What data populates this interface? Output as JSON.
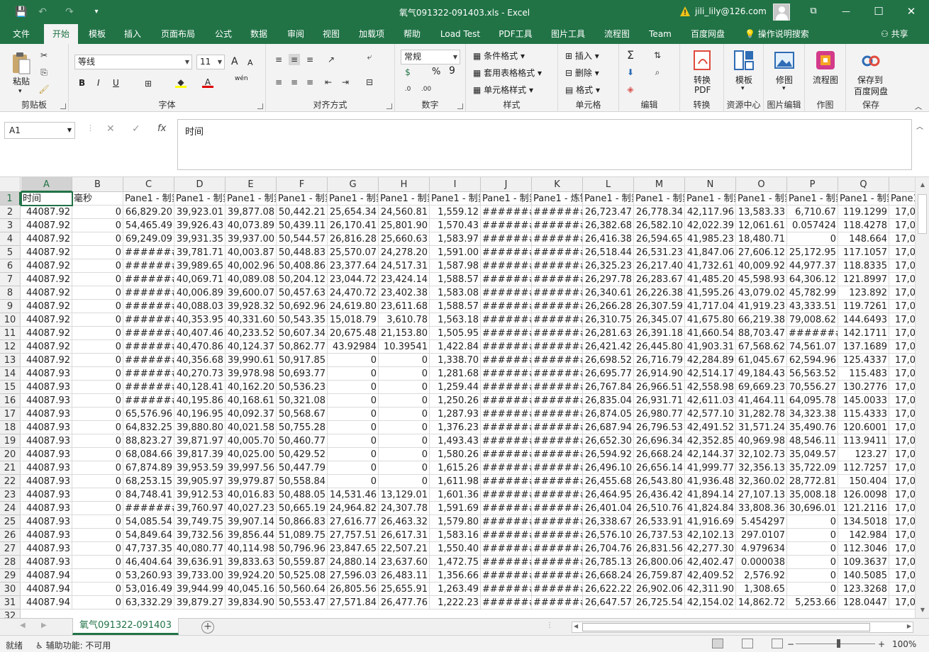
{
  "title_bar": {
    "title": "氧气091322-091403.xls  -  Excel",
    "user": "jili_lily@126.com",
    "qa_save": "💾",
    "qa_undo": "↶",
    "qa_redo": "↷",
    "qa_more": "▾",
    "minimize": "—",
    "restore": "☐",
    "close": "✕",
    "ribbon_opts": "⧉"
  },
  "menu": {
    "tabs": [
      "文件",
      "开始",
      "模板",
      "插入",
      "页面布局",
      "公式",
      "数据",
      "审阅",
      "视图",
      "加载项",
      "帮助",
      "Load Test",
      "PDF工具",
      "图片工具",
      "流程图",
      "Team",
      "百度网盘"
    ],
    "active": "开始",
    "search": "操作说明搜索",
    "share": "共享"
  },
  "ribbon": {
    "clipboard": {
      "label": "剪贴板",
      "paste": "粘贴"
    },
    "font": {
      "label": "字体",
      "name": "等线",
      "size": "11",
      "bold": "B",
      "italic": "I",
      "underline": "U",
      "grow": "A",
      "shrink": "A",
      "wen": "wén"
    },
    "align": {
      "label": "对齐方式"
    },
    "number": {
      "label": "数字",
      "format": "常规",
      "percent": "%",
      "comma": "9"
    },
    "styles": {
      "label": "样式",
      "cond": "条件格式",
      "table": "套用表格格式",
      "cell": "单元格样式"
    },
    "cells": {
      "label": "单元格",
      "insert": "插入",
      "delete": "删除",
      "format": "格式"
    },
    "edit": {
      "label": "编辑"
    },
    "convert": {
      "label": "转换",
      "btn1": "转换",
      "btn2": "PDF"
    },
    "template": {
      "label": "资源中心",
      "btn": "模板"
    },
    "image": {
      "label": "图片编辑",
      "btn": "修图"
    },
    "chart": {
      "label": "作图",
      "btn": "流程图"
    },
    "save": {
      "label": "保存",
      "btn1": "保存到",
      "btn2": "百度网盘"
    }
  },
  "formula_bar": {
    "name_box": "A1",
    "content": "时间",
    "cancel": "✕",
    "enter": "✓",
    "fx": "fx"
  },
  "sheet": {
    "columns": [
      "A",
      "B",
      "C",
      "D",
      "E",
      "F",
      "G",
      "H",
      "I",
      "J",
      "K",
      "L",
      "M",
      "N",
      "O",
      "P",
      "Q",
      ""
    ],
    "header_row": [
      "时间",
      "毫秒",
      "Pane1 - 制氢",
      "Pane1 - 制氢",
      "Pane1 - 制氢",
      "Pane1 - 制氢",
      "Pane1 - 制氢",
      "Pane1 - 制氢",
      "Pane1 - 制氢",
      "Pane1 - 制氢",
      "Pane1 - 炼铁",
      "Pane1 - 制氢",
      "Pane1 - 制氢",
      "Pane1 - 制氢",
      "Pane1 - 制氢",
      "Pane1 - 制氢",
      "Pane1 - 制氢",
      "Pane1"
    ],
    "rows": [
      [
        "44087.92",
        "0",
        "66,829.20",
        "39,923.01",
        "39,877.08",
        "50,442.21",
        "25,654.34",
        "24,560.81",
        "1,559.12",
        "#######",
        "#######",
        "26,723.47",
        "26,778.34",
        "42,117.96",
        "13,583.33",
        "6,710.67",
        "119.1299",
        "17,0"
      ],
      [
        "44087.92",
        "0",
        "54,465.49",
        "39,926.43",
        "40,073.89",
        "50,439.11",
        "26,170.41",
        "25,801.90",
        "1,570.43",
        "#######",
        "#######",
        "26,382.68",
        "26,582.10",
        "42,022.39",
        "12,061.61",
        "0.057424",
        "118.4278",
        "17,0"
      ],
      [
        "44087.92",
        "0",
        "69,249.09",
        "39,931.35",
        "39,937.00",
        "50,544.57",
        "26,816.28",
        "25,660.63",
        "1,583.97",
        "#######",
        "#######",
        "26,416.38",
        "26,594.65",
        "41,985.23",
        "18,480.71",
        "0",
        "148.664",
        "17,0"
      ],
      [
        "44087.92",
        "0",
        "#######",
        "39,781.71",
        "40,003.87",
        "50,448.83",
        "25,570.07",
        "24,278.20",
        "1,591.00",
        "#######",
        "#######",
        "26,518.44",
        "26,531.23",
        "41,847.06",
        "27,606.12",
        "25,172.95",
        "117.1057",
        "17,0"
      ],
      [
        "44087.92",
        "0",
        "#######",
        "39,989.65",
        "40,002.96",
        "50,408.86",
        "23,377.64",
        "24,517.31",
        "1,587.98",
        "#######",
        "#######",
        "26,325.23",
        "26,217.40",
        "41,732.61",
        "40,009.92",
        "44,977.37",
        "118.8335",
        "17,0"
      ],
      [
        "44087.92",
        "0",
        "#######",
        "40,069.71",
        "40,089.08",
        "50,204.12",
        "23,044.72",
        "23,424.14",
        "1,588.57",
        "#######",
        "#######",
        "26,297.78",
        "26,283.67",
        "41,485.20",
        "45,598.93",
        "64,306.12",
        "121.8997",
        "17,0"
      ],
      [
        "44087.92",
        "0",
        "#######",
        "40,006.89",
        "39,600.07",
        "50,457.63",
        "24,470.72",
        "23,402.38",
        "1,583.08",
        "#######",
        "#######",
        "26,340.61",
        "26,226.38",
        "41,595.26",
        "43,079.02",
        "45,782.99",
        "123.892",
        "17,0"
      ],
      [
        "44087.92",
        "0",
        "#######",
        "40,088.03",
        "39,928.32",
        "50,692.96",
        "24,619.80",
        "23,611.68",
        "1,588.57",
        "#######",
        "#######",
        "26,266.28",
        "26,307.59",
        "41,717.04",
        "41,919.23",
        "43,333.51",
        "119.7261",
        "17,0"
      ],
      [
        "44087.92",
        "0",
        "#######",
        "40,353.95",
        "40,331.60",
        "50,543.35",
        "15,018.79",
        "3,610.78",
        "1,563.18",
        "#######",
        "#######",
        "26,310.75",
        "26,345.07",
        "41,675.80",
        "66,219.38",
        "79,008.62",
        "144.6493",
        "17,0"
      ],
      [
        "44087.92",
        "0",
        "#######",
        "40,407.46",
        "40,233.52",
        "50,607.34",
        "20,675.48",
        "21,153.80",
        "1,505.95",
        "#######",
        "#######",
        "26,281.63",
        "26,391.18",
        "41,660.54",
        "88,703.47",
        "#######",
        "142.1711",
        "17,0"
      ],
      [
        "44087.92",
        "0",
        "#######",
        "40,470.86",
        "40,124.37",
        "50,862.77",
        "43.92984",
        "10.39541",
        "1,422.84",
        "#######",
        "#######",
        "26,421.42",
        "26,445.80",
        "41,903.31",
        "67,568.62",
        "74,561.07",
        "137.1689",
        "17,0"
      ],
      [
        "44087.92",
        "0",
        "#######",
        "40,356.68",
        "39,990.61",
        "50,917.85",
        "0",
        "0",
        "1,338.70",
        "#######",
        "#######",
        "26,698.52",
        "26,716.79",
        "42,284.89",
        "61,045.67",
        "62,594.96",
        "125.4337",
        "17,0"
      ],
      [
        "44087.93",
        "0",
        "#######",
        "40,270.73",
        "39,978.98",
        "50,693.77",
        "0",
        "0",
        "1,281.68",
        "#######",
        "#######",
        "26,695.77",
        "26,914.90",
        "42,514.17",
        "49,184.43",
        "56,563.52",
        "115.483",
        "17,0"
      ],
      [
        "44087.93",
        "0",
        "#######",
        "40,128.41",
        "40,162.20",
        "50,536.23",
        "0",
        "0",
        "1,259.44",
        "#######",
        "#######",
        "26,767.84",
        "26,966.51",
        "42,558.98",
        "69,669.23",
        "70,556.27",
        "130.2776",
        "17,0"
      ],
      [
        "44087.93",
        "0",
        "#######",
        "40,195.86",
        "40,168.61",
        "50,321.08",
        "0",
        "0",
        "1,250.26",
        "#######",
        "#######",
        "26,835.04",
        "26,931.71",
        "42,611.03",
        "41,464.11",
        "64,095.78",
        "145.0033",
        "17,0"
      ],
      [
        "44087.93",
        "0",
        "65,576.96",
        "40,196.95",
        "40,092.37",
        "50,568.67",
        "0",
        "0",
        "1,287.93",
        "#######",
        "#######",
        "26,874.05",
        "26,980.77",
        "42,577.10",
        "31,282.78",
        "34,323.38",
        "115.4333",
        "17,0"
      ],
      [
        "44087.93",
        "0",
        "64,832.25",
        "39,880.80",
        "40,021.58",
        "50,755.28",
        "0",
        "0",
        "1,376.23",
        "#######",
        "#######",
        "26,687.94",
        "26,796.53",
        "42,491.52",
        "31,571.24",
        "35,490.76",
        "120.6001",
        "17,0"
      ],
      [
        "44087.93",
        "0",
        "88,823.27",
        "39,871.97",
        "40,005.70",
        "50,460.77",
        "0",
        "0",
        "1,493.43",
        "#######",
        "#######",
        "26,652.30",
        "26,696.34",
        "42,352.85",
        "40,969.98",
        "48,546.11",
        "113.9411",
        "17,0"
      ],
      [
        "44087.93",
        "0",
        "68,084.66",
        "39,817.39",
        "40,025.00",
        "50,429.52",
        "0",
        "0",
        "1,580.26",
        "#######",
        "#######",
        "26,594.92",
        "26,668.24",
        "42,144.37",
        "32,102.73",
        "35,049.57",
        "123.27",
        "17,0"
      ],
      [
        "44087.93",
        "0",
        "67,874.89",
        "39,953.59",
        "39,997.56",
        "50,447.79",
        "0",
        "0",
        "1,615.26",
        "#######",
        "#######",
        "26,496.10",
        "26,656.14",
        "41,999.77",
        "32,356.13",
        "35,722.09",
        "112.7257",
        "17,0"
      ],
      [
        "44087.93",
        "0",
        "68,253.15",
        "39,905.97",
        "39,979.87",
        "50,558.84",
        "0",
        "0",
        "1,611.98",
        "#######",
        "#######",
        "26,455.68",
        "26,543.80",
        "41,936.48",
        "32,360.02",
        "28,772.81",
        "150.404",
        "17,0"
      ],
      [
        "44087.93",
        "0",
        "84,748.41",
        "39,912.53",
        "40,016.83",
        "50,488.05",
        "14,531.46",
        "13,129.01",
        "1,601.36",
        "#######",
        "#######",
        "26,464.95",
        "26,436.42",
        "41,894.14",
        "27,107.13",
        "35,008.18",
        "126.0098",
        "17,0"
      ],
      [
        "44087.93",
        "0",
        "#######",
        "39,760.97",
        "40,027.23",
        "50,665.19",
        "24,964.82",
        "24,307.78",
        "1,591.69",
        "#######",
        "#######",
        "26,401.04",
        "26,510.76",
        "41,824.84",
        "33,808.36",
        "30,696.01",
        "121.2116",
        "17,0"
      ],
      [
        "44087.93",
        "0",
        "54,085.54",
        "39,749.75",
        "39,907.14",
        "50,866.83",
        "27,616.77",
        "26,463.32",
        "1,579.80",
        "#######",
        "#######",
        "26,338.67",
        "26,533.91",
        "41,916.69",
        "5.454297",
        "0",
        "134.5018",
        "17,0"
      ],
      [
        "44087.93",
        "0",
        "54,849.64",
        "39,732.56",
        "39,856.44",
        "51,089.75",
        "27,757.51",
        "26,617.31",
        "1,583.16",
        "#######",
        "#######",
        "26,576.10",
        "26,737.53",
        "42,102.13",
        "297.0107",
        "0",
        "142.984",
        "17,0"
      ],
      [
        "44087.93",
        "0",
        "47,737.35",
        "40,080.77",
        "40,114.98",
        "50,796.96",
        "23,847.65",
        "22,507.21",
        "1,550.40",
        "#######",
        "#######",
        "26,704.76",
        "26,831.56",
        "42,277.30",
        "4.979634",
        "0",
        "112.3046",
        "17,0"
      ],
      [
        "44087.93",
        "0",
        "46,404.64",
        "39,636.91",
        "39,833.63",
        "50,559.87",
        "24,880.14",
        "23,637.60",
        "1,472.75",
        "#######",
        "#######",
        "26,785.13",
        "26,800.06",
        "42,402.47",
        "0.000038",
        "0",
        "109.3637",
        "17,0"
      ],
      [
        "44087.94",
        "0",
        "53,260.93",
        "39,733.00",
        "39,924.20",
        "50,525.08",
        "27,596.03",
        "26,483.11",
        "1,356.66",
        "#######",
        "#######",
        "26,668.24",
        "26,759.87",
        "42,409.52",
        "2,576.92",
        "0",
        "140.5085",
        "17,0"
      ],
      [
        "44087.94",
        "0",
        "53,016.49",
        "39,944.99",
        "40,045.16",
        "50,560.64",
        "26,805.56",
        "25,655.91",
        "1,263.49",
        "#######",
        "#######",
        "26,622.22",
        "26,902.06",
        "42,311.90",
        "1,308.65",
        "0",
        "123.3268",
        "17,0"
      ],
      [
        "44087.94",
        "0",
        "63,332.29",
        "39,879.27",
        "39,834.90",
        "50,553.47",
        "27,571.84",
        "26,477.76",
        "1,222.23",
        "#######",
        "#######",
        "26,647.57",
        "26,725.54",
        "42,154.02",
        "14,862.72",
        "5,253.66",
        "128.0447",
        "17,0"
      ]
    ],
    "tab_name": "氧气091322-091403"
  },
  "status_bar": {
    "ready": "就绪",
    "accessibility": "辅助功能: 不可用",
    "zoom": "100%",
    "minus": "−",
    "plus": "+"
  },
  "colors": {
    "excel_green": "#217346"
  }
}
